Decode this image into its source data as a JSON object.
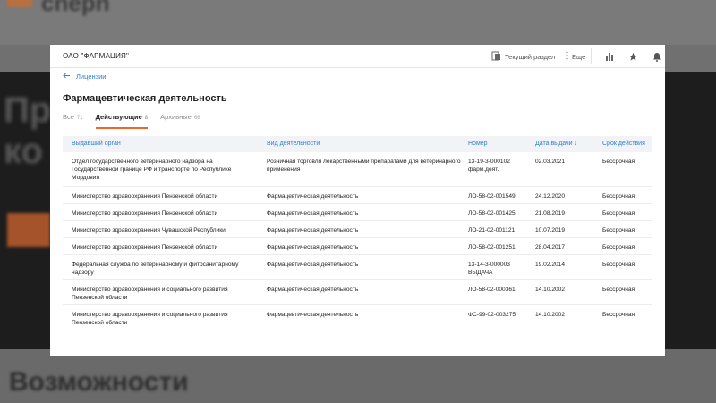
{
  "background": {
    "logo_text": "cnepn",
    "hero_text": "Пр\nко",
    "bottom_text": "Возможности"
  },
  "header": {
    "company": "ОАО \"ФАРМАЦИЯ\"",
    "current_section": "Текущий раздел",
    "more": "Еще"
  },
  "back_link": "Лицензии",
  "title": "Фармацевтическая деятельность",
  "tabs": [
    {
      "label": "Все",
      "count": "71"
    },
    {
      "label": "Действующие",
      "count": "8"
    },
    {
      "label": "Архивные",
      "count": "66"
    }
  ],
  "columns": [
    "Выдавший орган",
    "Вид деятельности",
    "Номер",
    "Дата выдачи ↓",
    "Срок действия"
  ],
  "rows": [
    {
      "authority": "Отдел государственного ветеринарного надзора на Государственной границе РФ и транспорте по Республике Мордовия",
      "activity": "Розничная торговля лекарственными препаратами для ветеринарного применения",
      "number": "13-19-3-000102 фарм.деят.",
      "date": "02.03.2021",
      "term": "Бессрочная"
    },
    {
      "authority": "Министерство здравоохранения Пензенской области",
      "activity": "Фармацевтическая деятельность",
      "number": "ЛО-58-02-001549",
      "date": "24.12.2020",
      "term": "Бессрочная"
    },
    {
      "authority": "Министерство здравоохранения Пензенской области",
      "activity": "Фармацевтическая деятельность",
      "number": "ЛО-58-02-001425",
      "date": "21.08.2019",
      "term": "Бессрочная"
    },
    {
      "authority": "Министерство здравоохранения Чувашской Республики",
      "activity": "Фармацевтическая деятельность",
      "number": "ЛО-21-02-001121",
      "date": "10.07.2019",
      "term": "Бессрочная"
    },
    {
      "authority": "Министерство здравоохранения Пензенской области",
      "activity": "Фармацевтическая деятельность",
      "number": "ЛО-58-02-001251",
      "date": "28.04.2017",
      "term": "Бессрочная"
    },
    {
      "authority": "Федеральная служба по ветеринарному и фитосанитарному надзору",
      "activity": "Фармацевтическая деятельность",
      "number": "13-14-3-000003 ВЫДАЧА",
      "date": "19.02.2014",
      "term": "Бессрочная"
    },
    {
      "authority": "Министерство здравоохранения и социального развития Пензенской области",
      "activity": "Фармацевтическая деятельность",
      "number": "ЛО-58-02-000361",
      "date": "14.10.2002",
      "term": "Бессрочная"
    },
    {
      "authority": "Министерство здравоохранения и социального развития Пензенской области",
      "activity": "Фармацевтическая деятельность",
      "number": "ФС-99-02-003275",
      "date": "14.10.2002",
      "term": "Бессрочная"
    }
  ],
  "colors": {
    "accent": "#e8692a",
    "link": "#2f7fd0"
  }
}
